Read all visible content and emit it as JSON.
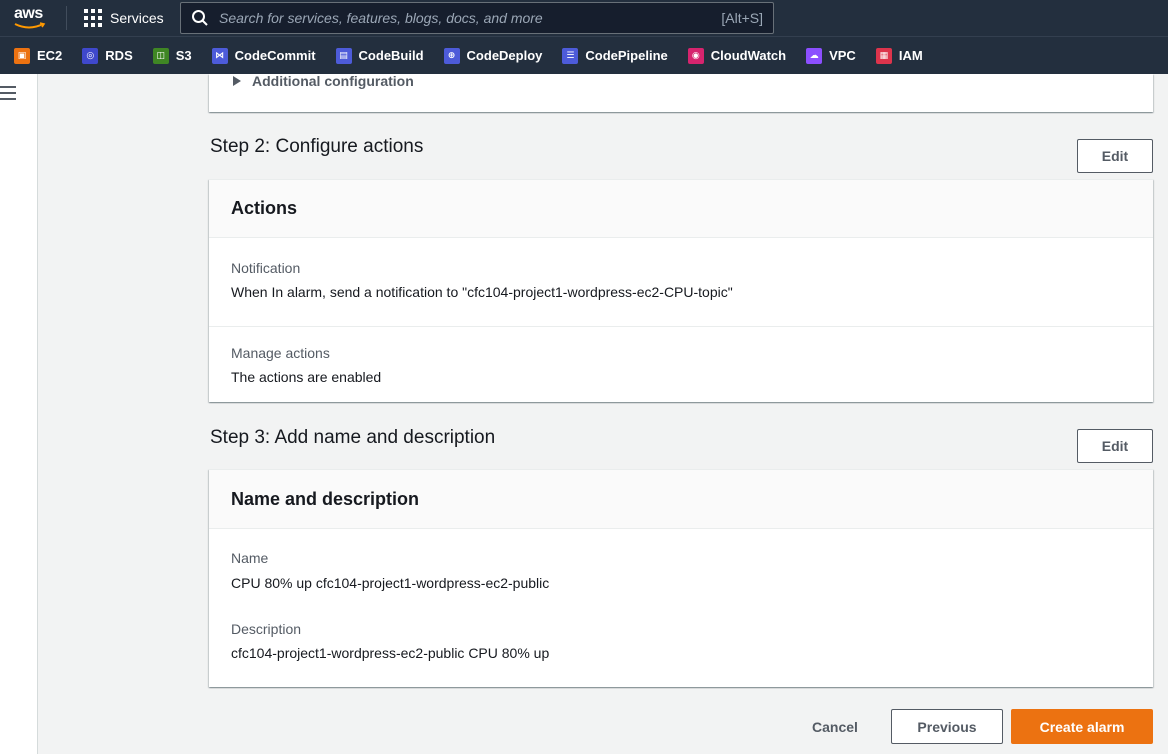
{
  "topnav": {
    "logo": "aws",
    "services_label": "Services",
    "search_placeholder": "Search for services, features, blogs, docs, and more",
    "search_shortcut": "[Alt+S]"
  },
  "favorites": [
    {
      "label": "EC2",
      "icon": "ec2-icon",
      "color": "#ec7211"
    },
    {
      "label": "RDS",
      "icon": "rds-icon",
      "color": "#3f48cc"
    },
    {
      "label": "S3",
      "icon": "s3-icon",
      "color": "#3f8624"
    },
    {
      "label": "CodeCommit",
      "icon": "codecommit-icon",
      "color": "#4d5bd9"
    },
    {
      "label": "CodeBuild",
      "icon": "codebuild-icon",
      "color": "#4d5bd9"
    },
    {
      "label": "CodeDeploy",
      "icon": "codedeploy-icon",
      "color": "#4d5bd9"
    },
    {
      "label": "CodePipeline",
      "icon": "codepipeline-icon",
      "color": "#4d5bd9"
    },
    {
      "label": "CloudWatch",
      "icon": "cloudwatch-icon",
      "color": "#d6246e"
    },
    {
      "label": "VPC",
      "icon": "vpc-icon",
      "color": "#8c4fff"
    },
    {
      "label": "IAM",
      "icon": "iam-icon",
      "color": "#dd344c"
    }
  ],
  "step1": {
    "additional_configuration": "Additional configuration"
  },
  "step2": {
    "title": "Step 2: Configure actions",
    "edit_label": "Edit",
    "card_title": "Actions",
    "notification_label": "Notification",
    "notification_value": "When In alarm, send a notification to \"cfc104-project1-wordpress-ec2-CPU-topic\"",
    "manage_label": "Manage actions",
    "manage_value": "The actions are enabled"
  },
  "step3": {
    "title": "Step 3: Add name and description",
    "edit_label": "Edit",
    "card_title": "Name and description",
    "name_label": "Name",
    "name_value": "CPU 80% up cfc104-project1-wordpress-ec2-public",
    "description_label": "Description",
    "description_value": "cfc104-project1-wordpress-ec2-public CPU 80% up"
  },
  "footer": {
    "cancel_label": "Cancel",
    "previous_label": "Previous",
    "create_label": "Create alarm"
  }
}
